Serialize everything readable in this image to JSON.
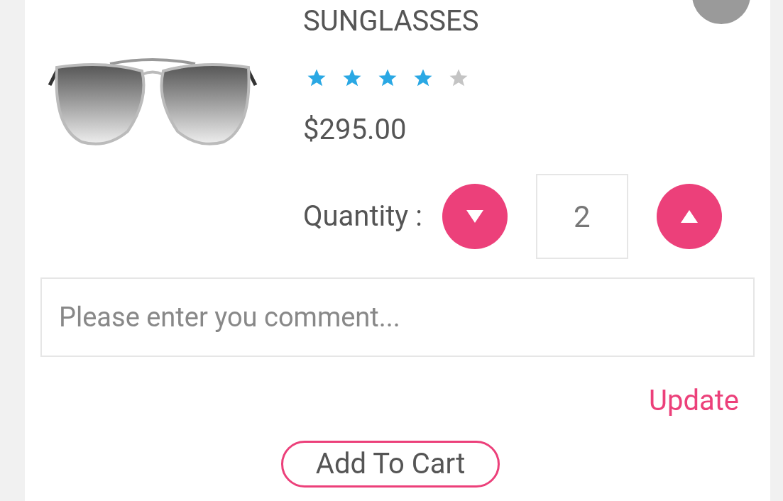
{
  "product": {
    "name": "SUNGLASSES",
    "stars": 4,
    "price": "$295.00",
    "quantity_label": "Quantity :",
    "quantity": "2"
  },
  "comment": {
    "placeholder": "Please enter you comment..."
  },
  "update_link": "Update",
  "add_to_cart": "Add To Cart"
}
